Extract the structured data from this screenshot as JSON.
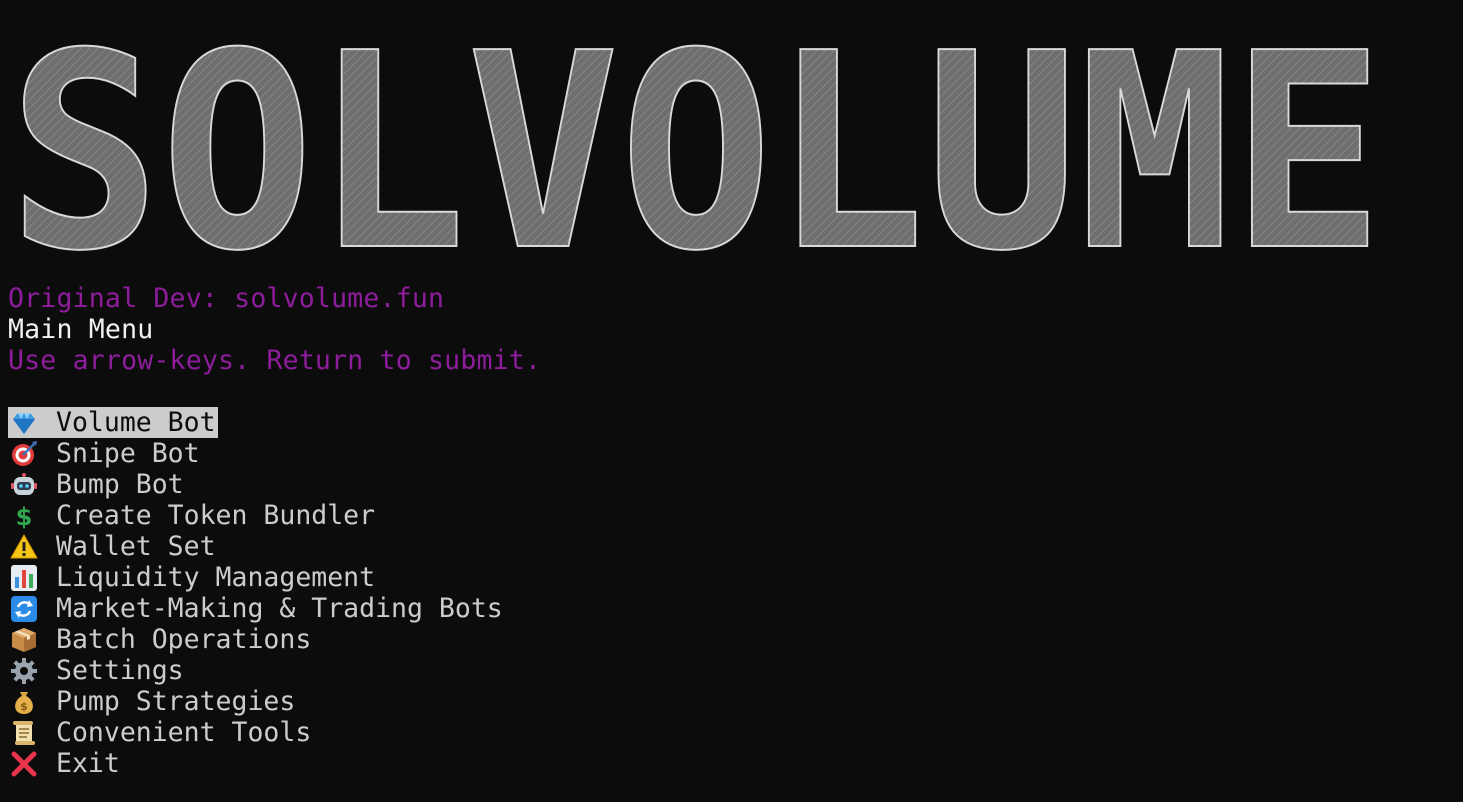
{
  "banner": {
    "text": "SOLVOLUME",
    "fill_color": "#6e6e6e",
    "line_color": "#d9d9d9"
  },
  "header": {
    "dev_line": "Original Dev: solvolume.fun",
    "title": "Main Menu",
    "help": "Use arrow-keys. Return to submit."
  },
  "colors": {
    "accent": "#8e1d9c",
    "background": "#0c0c0c",
    "menu_text": "#cccccc",
    "selection_bg": "#cccccc"
  },
  "menu": {
    "selected_index": 0,
    "items": [
      {
        "icon": "gem-icon",
        "label": "Volume Bot"
      },
      {
        "icon": "target-icon",
        "label": "Snipe Bot"
      },
      {
        "icon": "robot-icon",
        "label": "Bump Bot"
      },
      {
        "icon": "dollar-icon",
        "label": "Create Token Bundler"
      },
      {
        "icon": "warning-icon",
        "label": "Wallet Set"
      },
      {
        "icon": "bar-chart-icon",
        "label": "Liquidity Management"
      },
      {
        "icon": "refresh-icon",
        "label": "Market-Making & Trading Bots"
      },
      {
        "icon": "package-icon",
        "label": "Batch Operations"
      },
      {
        "icon": "gear-icon",
        "label": "Settings"
      },
      {
        "icon": "money-bag-icon",
        "label": "Pump Strategies"
      },
      {
        "icon": "scroll-icon",
        "label": "Convenient Tools"
      },
      {
        "icon": "cross-mark-icon",
        "label": "Exit"
      }
    ]
  }
}
